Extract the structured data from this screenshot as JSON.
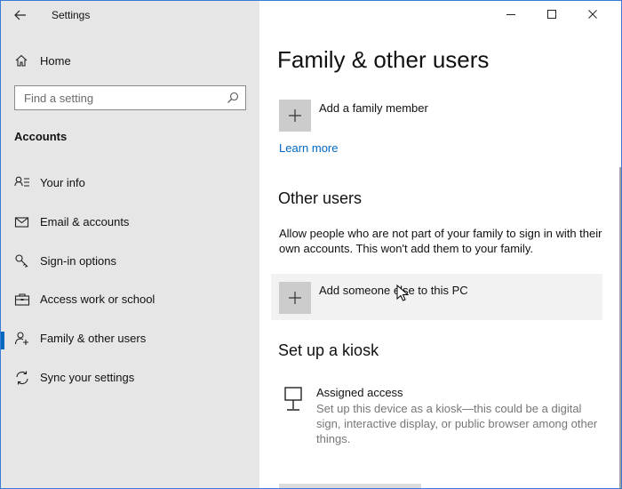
{
  "app": {
    "title": "Settings"
  },
  "sidebar": {
    "home_label": "Home",
    "search_placeholder": "Find a setting",
    "section_title": "Accounts",
    "items": [
      {
        "label": "Your info",
        "icon": "person-list-icon"
      },
      {
        "label": "Email & accounts",
        "icon": "mail-icon"
      },
      {
        "label": "Sign-in options",
        "icon": "key-icon"
      },
      {
        "label": "Access work or school",
        "icon": "briefcase-icon"
      },
      {
        "label": "Family & other users",
        "icon": "person-add-icon",
        "active": true
      },
      {
        "label": "Sync your settings",
        "icon": "sync-icon"
      }
    ]
  },
  "main": {
    "title": "Family & other users",
    "add_family_label": "Add a family member",
    "learn_more": "Learn more",
    "other_users": {
      "heading": "Other users",
      "description": "Allow people who are not part of your family to sign in with their own accounts. This won't add them to your family.",
      "add_label": "Add someone else to this PC"
    },
    "kiosk": {
      "heading": "Set up a kiosk",
      "item_title": "Assigned access",
      "item_description": "Set up this device as a kiosk—this could be a digital sign, interactive display, or public browser among other things."
    }
  },
  "colors": {
    "accent": "#0067c0",
    "sidebar_bg": "#e6e6e6",
    "tile_bg": "#cccccc"
  }
}
